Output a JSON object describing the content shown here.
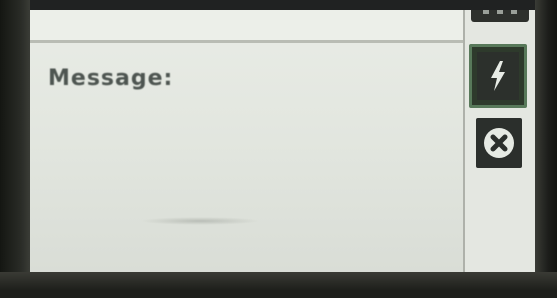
{
  "message": {
    "label": "Message:"
  },
  "side_buttons": [
    {
      "icon": "more-icon"
    },
    {
      "icon": "lightning-bolt-icon",
      "selected": true
    },
    {
      "icon": "cancel-icon"
    }
  ],
  "colors": {
    "screen": "#e6e9e3",
    "label_text": "#4e5551",
    "button_dark": "#2c302c",
    "selected_outline": "#58795a"
  }
}
